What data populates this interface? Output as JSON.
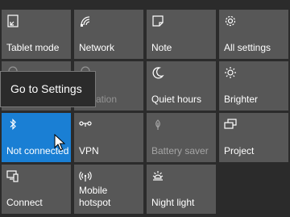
{
  "tiles": [
    {
      "label": "Tablet mode",
      "icon": "tablet-mode-icon",
      "state": "normal"
    },
    {
      "label": "Network",
      "icon": "network-icon",
      "state": "normal"
    },
    {
      "label": "Note",
      "icon": "note-icon",
      "state": "normal"
    },
    {
      "label": "All settings",
      "icon": "gear-icon",
      "state": "normal"
    },
    {
      "label": "",
      "icon": "location-icon",
      "state": "covered"
    },
    {
      "label": "ation",
      "icon": "location-icon",
      "state": "covered"
    },
    {
      "label": "Quiet hours",
      "icon": "moon-icon",
      "state": "normal"
    },
    {
      "label": "Brighter",
      "icon": "brightness-icon",
      "state": "normal"
    },
    {
      "label": "Not connected",
      "icon": "bluetooth-icon",
      "state": "active"
    },
    {
      "label": "VPN",
      "icon": "vpn-icon",
      "state": "normal"
    },
    {
      "label": "Battery saver",
      "icon": "battery-saver-icon",
      "state": "disabled"
    },
    {
      "label": "Project",
      "icon": "project-icon",
      "state": "normal"
    },
    {
      "label": "Connect",
      "icon": "connect-icon",
      "state": "normal"
    },
    {
      "label_line1": "Mobile",
      "label_line2": "hotspot",
      "icon": "mobile-hotspot-icon",
      "state": "normal"
    },
    {
      "label": "Night light",
      "icon": "night-light-icon",
      "state": "normal"
    }
  ],
  "tooltip": {
    "text": "Go to Settings"
  },
  "colors": {
    "background": "#2b2b2b",
    "tile": "#575757",
    "tile_active": "#1a7fd4",
    "text": "#ffffff"
  }
}
